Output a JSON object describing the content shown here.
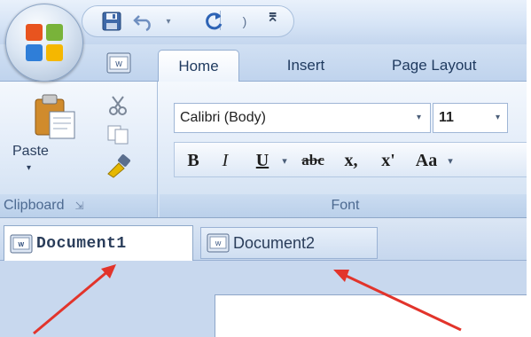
{
  "ribbon_tabs": [
    {
      "label": "Home"
    },
    {
      "label": "Insert"
    },
    {
      "label": "Page Layout"
    }
  ],
  "clipboard": {
    "paste_label": "Paste",
    "group_label": "Clipboard"
  },
  "font": {
    "font_name": "Calibri (Body)",
    "font_size": "11",
    "group_label": "Font",
    "buttons": {
      "bold": "B",
      "italic": "I",
      "underline": "U",
      "strikethrough": "abc",
      "subscript": "x,",
      "superscript": "x'",
      "change_case": "Aa"
    }
  },
  "documents": {
    "tabs": [
      {
        "label": "Document1"
      },
      {
        "label": "Document2"
      }
    ]
  },
  "colors": {
    "arrow": "#e2342b",
    "accent": "#2b579a"
  }
}
